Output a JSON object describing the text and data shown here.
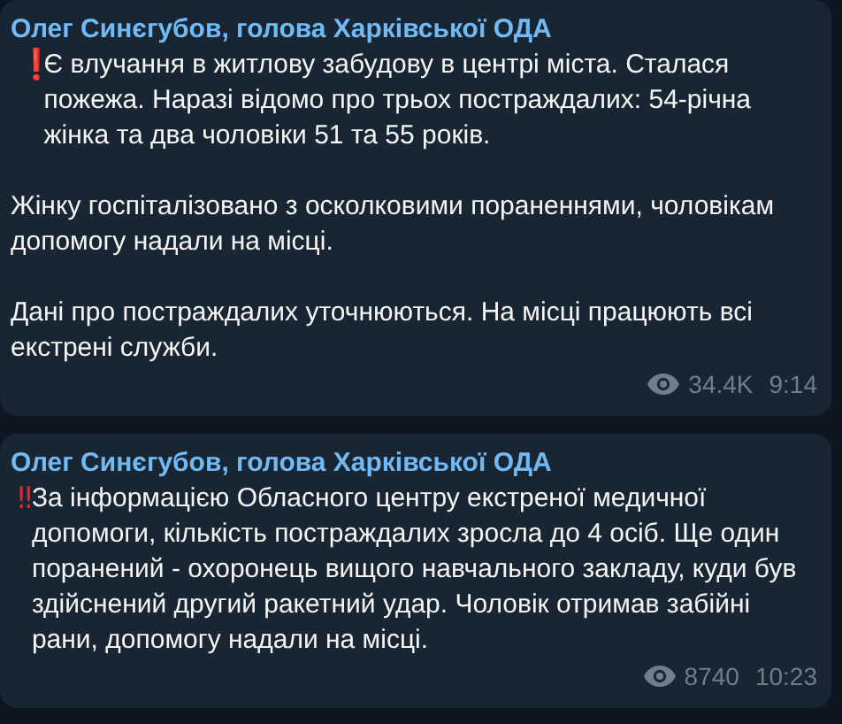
{
  "messages": [
    {
      "author": "Олег Синєгубов, голова Харківської ОДА",
      "emoji": "❗",
      "paragraphs": [
        "Є влучання в житлову забудову в центрі міста. Сталася пожежа. Наразі відомо про трьох постраждалих: 54-річна жінка та два чоловіки 51 та 55 років.",
        "Жінку госпіталізовано з осколковими пораненнями, чоловікам допомогу надали на місці.",
        "Дані про постраждалих уточнюються. На місці працюють всі екстрені служби."
      ],
      "views": "34.4K",
      "time": "9:14"
    },
    {
      "author": "Олег Синєгубов, голова Харківської ОДА",
      "emoji": "‼",
      "paragraphs": [
        "За інформацією Обласного центру екстреної медичної допомоги, кількість постраждалих зросла до 4 осіб. Ще один поранений - охоронець вищого навчального закладу, куди був здійснений другий ракетний удар. Чоловік отримав забійні рани, допомогу надали на місці."
      ],
      "views": "8740",
      "time": "10:23"
    }
  ]
}
